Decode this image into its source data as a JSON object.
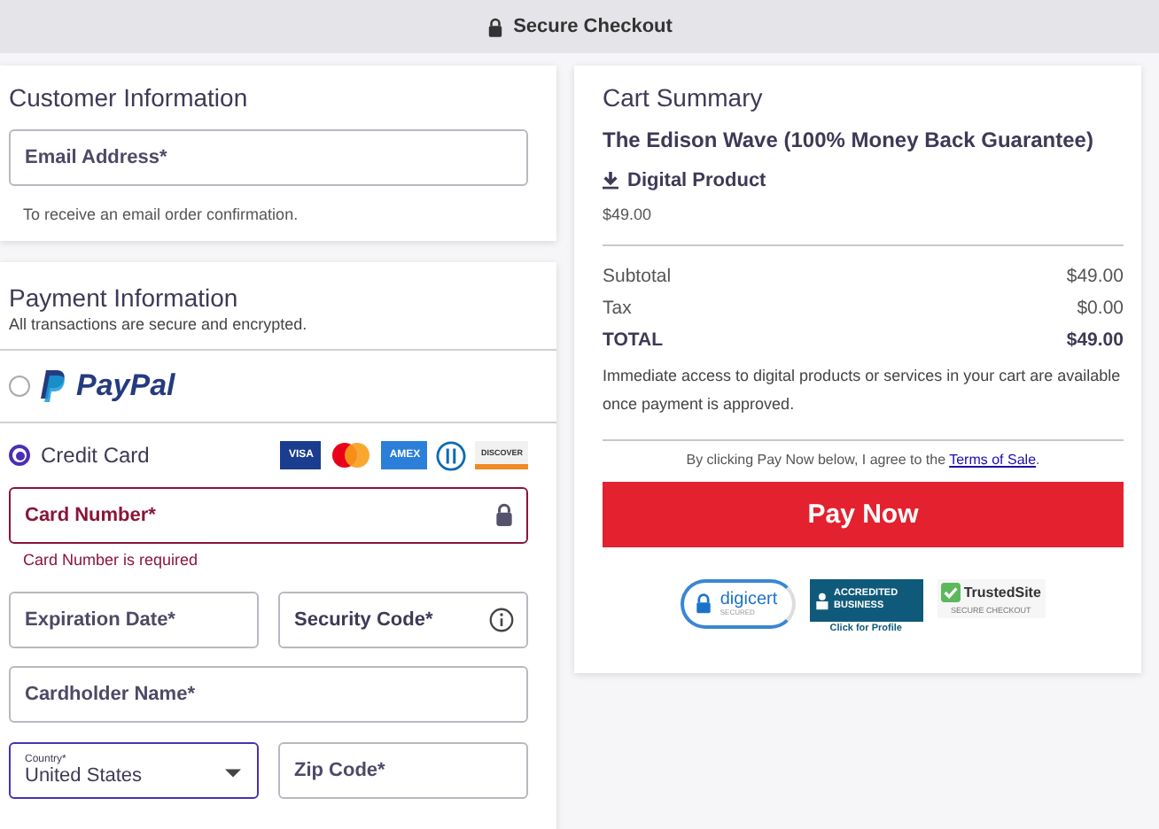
{
  "top_bar": {
    "title": "Secure Checkout"
  },
  "customer": {
    "title": "Customer Information",
    "email": {
      "placeholder": "Email Address*"
    },
    "hint": "To receive an email order confirmation."
  },
  "payment": {
    "title": "Payment Information",
    "subtitle": "All transactions are secure and encrypted.",
    "options": [
      {
        "kind": "paypal",
        "label": "PayPal",
        "selected": false
      },
      {
        "kind": "card",
        "label": "Credit Card",
        "selected": true
      }
    ],
    "card_logos": [
      {
        "kind": "visa",
        "label": "VISA"
      },
      {
        "kind": "mastercard"
      },
      {
        "kind": "amex",
        "label": "AMEX"
      },
      {
        "kind": "diners"
      },
      {
        "kind": "discover",
        "label": "DISCOVER"
      }
    ],
    "card_number": {
      "placeholder": "Card Number*",
      "error": "Card Number is required"
    },
    "expiration": {
      "placeholder": "Expiration Date*"
    },
    "security_code": {
      "placeholder": "Security Code*"
    },
    "cardholder": {
      "placeholder": "Cardholder Name*"
    },
    "country": {
      "label": "Country*",
      "value": "United States"
    },
    "zip": {
      "placeholder": "Zip Code*"
    }
  },
  "cart": {
    "title": "Cart Summary",
    "product": "The Edison Wave (100% Money Back Guarantee)",
    "product_type": "Digital Product",
    "product_price": "$49.00",
    "lines": [
      {
        "label": "Subtotal",
        "value": "$49.00",
        "total": false
      },
      {
        "label": "Tax",
        "value": "$0.00",
        "total": false
      },
      {
        "label": "TOTAL",
        "value": "$49.00",
        "total": true
      }
    ],
    "note": "Immediate access to digital products or services in your cart are available once payment is approved.",
    "agree": "By clicking Pay Now below, I agree to the",
    "terms_link": "Terms of Sale",
    "agree_end": ".",
    "pay_button": "Pay Now",
    "badges": [
      {
        "kind": "digicert",
        "label": "digicert",
        "sub": "SECURED"
      },
      {
        "kind": "bbb",
        "label": "ACCREDITED BUSINESS",
        "sub": "Click for Profile"
      },
      {
        "kind": "trustedsite",
        "label": "TrustedSite",
        "sub": "SECURE CHECKOUT"
      }
    ]
  }
}
